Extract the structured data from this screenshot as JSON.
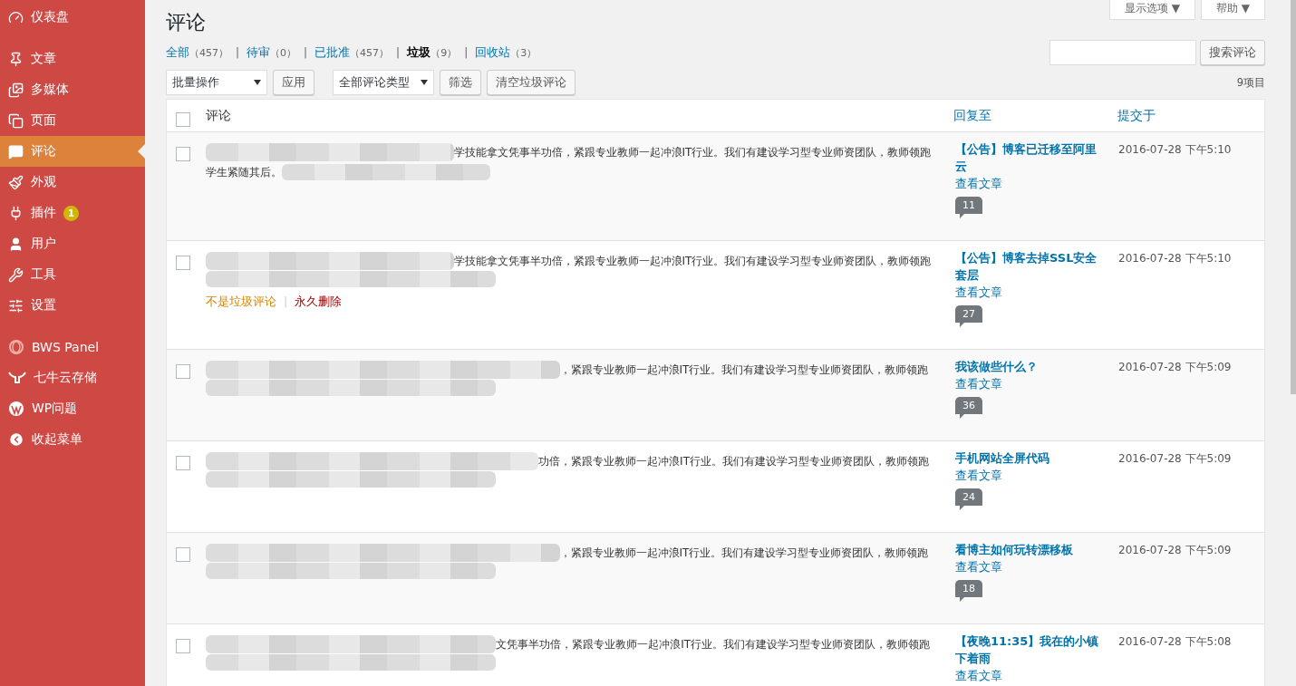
{
  "sidebar": {
    "groups": [
      {
        "items": [
          {
            "label": "仪表盘",
            "selected": false
          }
        ]
      },
      {
        "items": [
          {
            "label": "文章",
            "selected": false
          },
          {
            "label": "多媒体",
            "selected": false
          },
          {
            "label": "页面",
            "selected": false
          },
          {
            "label": "评论",
            "selected": true
          },
          {
            "label": "外观",
            "selected": false
          },
          {
            "label": "插件",
            "selected": false,
            "badge": "1"
          },
          {
            "label": "用户",
            "selected": false
          },
          {
            "label": "工具",
            "selected": false
          },
          {
            "label": "设置",
            "selected": false
          }
        ]
      },
      {
        "items": [
          {
            "label": "BWS Panel",
            "selected": false
          },
          {
            "label": "七牛云存储",
            "selected": false
          },
          {
            "label": "WP问题",
            "selected": false
          },
          {
            "label": "收起菜单",
            "selected": false
          }
        ]
      }
    ]
  },
  "screen_tabs": [
    "显示选项 ▼",
    "帮助 ▼"
  ],
  "title": "评论",
  "separator": "|",
  "filters": [
    {
      "label": "全部",
      "count": "（457）",
      "selected": false
    },
    {
      "label": "待审",
      "count": "（0）",
      "selected": false
    },
    {
      "label": "已批准",
      "count": "（457）",
      "selected": false
    },
    {
      "label": "垃圾",
      "count": "（9）",
      "selected": true
    },
    {
      "label": "回收站",
      "count": "（3）",
      "selected": false
    }
  ],
  "search": {
    "button": "搜索评论"
  },
  "bulk_actions": {
    "value": "批量操作",
    "apply": "应用"
  },
  "type_filter": {
    "value": "全部评论类型",
    "button": "筛选"
  },
  "empty_spam": "清空垃圾评论",
  "item_count": "9项目",
  "table": {
    "header_checked": false,
    "columns": [
      "评论",
      "回复至",
      "提交于"
    ],
    "rows": [
      {
        "checked": false,
        "line1": "学技能拿文凭事半功倍，紧跟专业教师一起冲浪IT行业。我们有建设学习型专业师资团队，教师领跑",
        "line2": "学生紧随其后。",
        "post": "【公告】博客已迁移至阿里云",
        "view": "查看文章",
        "comments": "11",
        "date": "2016-07-28 下午5:10"
      },
      {
        "checked": false,
        "line1": "学技能拿文凭事半功倍，紧跟专业教师一起冲浪IT行业。我们有建设学习型专业师资团队，教师领跑",
        "actions": [
          {
            "label": "不是垃圾评论",
            "kind": "unspam"
          },
          {
            "label": "永久删除",
            "kind": "delete"
          }
        ],
        "post": "【公告】博客去掉SSL安全套层",
        "view": "查看文章",
        "comments": "27",
        "date": "2016-07-28 下午5:10"
      },
      {
        "checked": false,
        "line1": "，紧跟专业教师一起冲浪IT行业。我们有建设学习型专业师资团队，教师领跑",
        "post": "我该做些什么？",
        "view": "查看文章",
        "comments": "36",
        "date": "2016-07-28 下午5:09"
      },
      {
        "checked": false,
        "line1": "功倍，紧跟专业教师一起冲浪IT行业。我们有建设学习型专业师资团队，教师领跑",
        "post": "手机网站全屏代码",
        "view": "查看文章",
        "comments": "24",
        "date": "2016-07-28 下午5:09"
      },
      {
        "checked": false,
        "line1": "，紧跟专业教师一起冲浪IT行业。我们有建设学习型专业师资团队，教师领跑",
        "post": "看博主如何玩转漂移板",
        "view": "查看文章",
        "comments": "18",
        "date": "2016-07-28 下午5:09"
      },
      {
        "checked": false,
        "line1": "文凭事半功倍，紧跟专业教师一起冲浪IT行业。我们有建设学习型专业师资团队，教师领跑",
        "post": "【夜晚11:35】我在的小镇下着雨",
        "view": "查看文章",
        "date": "2016-07-28 下午5:08"
      }
    ]
  }
}
